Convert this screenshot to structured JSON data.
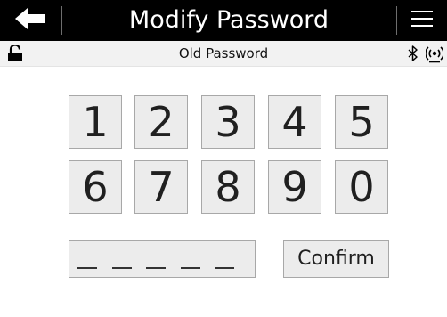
{
  "header": {
    "title": "Modify Password",
    "back_icon": "back-arrow-icon",
    "menu_icon": "hamburger-menu-icon"
  },
  "status": {
    "label": "Old Password",
    "icons": [
      "lock-icon",
      "bluetooth-icon",
      "wireless-signal-icon"
    ]
  },
  "keypad": {
    "row1": [
      "1",
      "2",
      "3",
      "4",
      "5"
    ],
    "row2": [
      "6",
      "7",
      "8",
      "9",
      "0"
    ]
  },
  "password": {
    "length": 5,
    "entered": 0
  },
  "confirm_label": "Confirm",
  "colors": {
    "header_bg": "#000000",
    "header_text": "#ffffff",
    "key_bg": "#ececec",
    "key_border": "#a8a8a8"
  }
}
